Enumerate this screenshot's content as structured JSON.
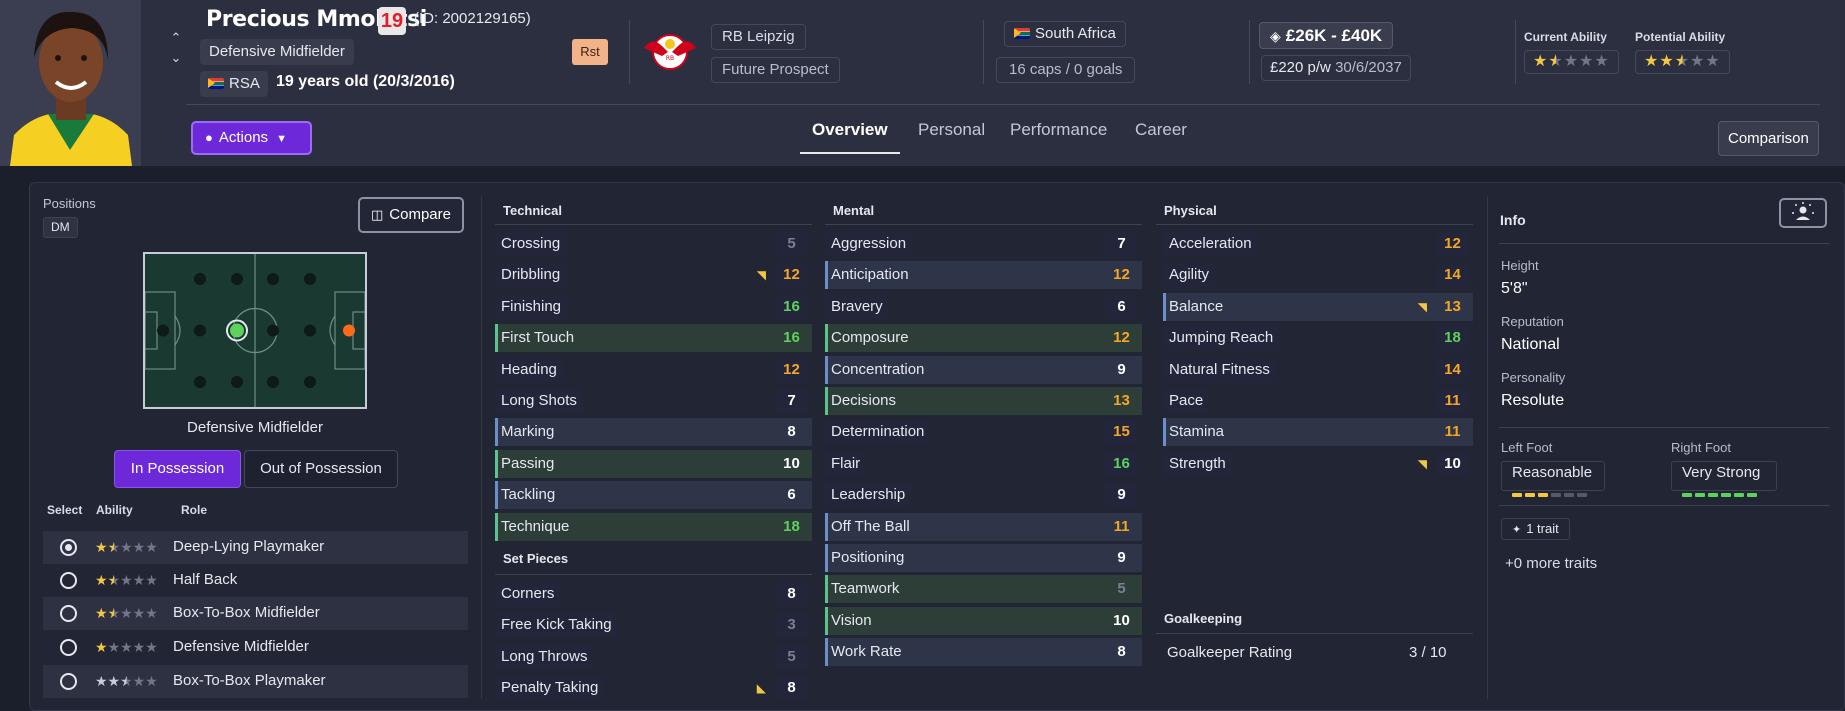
{
  "header": {
    "player_name": "Precious Mmolotsi",
    "age_badge": "19",
    "player_id": "(ID: 2002129165)",
    "position": "Defensive Midfielder",
    "nationality_code": "RSA",
    "age_dob": "19 years old (20/3/2016)",
    "rst_badge": "Rst",
    "club": "RB Leipzig",
    "club_status": "Future Prospect",
    "nation": "South Africa",
    "caps": "16 caps / 0 goals",
    "value": "£26K - £40K",
    "wage": "£220 p/w",
    "contract_end": "30/6/2037",
    "current_ability_label": "Current Ability",
    "potential_ability_label": "Potential Ability",
    "current_ability_stars": 1.5,
    "potential_ability_stars": 2.5,
    "actions_label": "Actions",
    "tabs": [
      "Overview",
      "Personal",
      "Performance",
      "Career"
    ],
    "active_tab": "Overview",
    "comparison_label": "Comparison"
  },
  "positions": {
    "label": "Positions",
    "chip": "DM",
    "compare_label": "Compare",
    "pitch_caption": "Defensive Midfielder",
    "in_possession": "In Possession",
    "out_of_possession": "Out of Possession",
    "columns": [
      "Select",
      "Ability",
      "Role"
    ],
    "roles": [
      {
        "name": "Deep-Lying Playmaker",
        "stars": 1.5,
        "selected": true,
        "star_color": "gold"
      },
      {
        "name": "Half Back",
        "stars": 1.5,
        "selected": false,
        "star_color": "gold"
      },
      {
        "name": "Box-To-Box Midfielder",
        "stars": 1.5,
        "selected": false,
        "star_color": "gold"
      },
      {
        "name": "Defensive Midfielder",
        "stars": 1,
        "selected": false,
        "star_color": "gold"
      },
      {
        "name": "Box-To-Box Playmaker",
        "stars": 2.5,
        "selected": false,
        "star_color": "silver"
      }
    ]
  },
  "technical": {
    "title": "Technical",
    "attributes": [
      {
        "name": "Crossing",
        "value": "5",
        "color": "gray",
        "highlight": "none",
        "trend": false
      },
      {
        "name": "Dribbling",
        "value": "12",
        "color": "orange",
        "highlight": "none",
        "trend": true
      },
      {
        "name": "Finishing",
        "value": "16",
        "color": "green",
        "highlight": "none",
        "trend": false
      },
      {
        "name": "First Touch",
        "value": "16",
        "color": "green",
        "highlight": "green",
        "trend": false
      },
      {
        "name": "Heading",
        "value": "12",
        "color": "orange",
        "highlight": "none",
        "trend": false
      },
      {
        "name": "Long Shots",
        "value": "7",
        "color": "white",
        "highlight": "none",
        "trend": false
      },
      {
        "name": "Marking",
        "value": "8",
        "color": "white",
        "highlight": "blue",
        "trend": false
      },
      {
        "name": "Passing",
        "value": "10",
        "color": "white",
        "highlight": "green",
        "trend": false
      },
      {
        "name": "Tackling",
        "value": "6",
        "color": "white",
        "highlight": "blue",
        "trend": false
      },
      {
        "name": "Technique",
        "value": "18",
        "color": "green",
        "highlight": "green",
        "trend": false
      }
    ]
  },
  "set_pieces": {
    "title": "Set Pieces",
    "attributes": [
      {
        "name": "Corners",
        "value": "8",
        "color": "white",
        "highlight": "none",
        "trend": false
      },
      {
        "name": "Free Kick Taking",
        "value": "3",
        "color": "gray",
        "highlight": "none",
        "trend": false
      },
      {
        "name": "Long Throws",
        "value": "5",
        "color": "gray",
        "highlight": "none",
        "trend": false
      },
      {
        "name": "Penalty Taking",
        "value": "8",
        "color": "white",
        "highlight": "none",
        "trend": "down"
      }
    ]
  },
  "mental": {
    "title": "Mental",
    "attributes": [
      {
        "name": "Aggression",
        "value": "7",
        "color": "white",
        "highlight": "none",
        "trend": false
      },
      {
        "name": "Anticipation",
        "value": "12",
        "color": "orange",
        "highlight": "blue",
        "trend": false
      },
      {
        "name": "Bravery",
        "value": "6",
        "color": "white",
        "highlight": "none",
        "trend": false
      },
      {
        "name": "Composure",
        "value": "12",
        "color": "orange",
        "highlight": "green",
        "trend": false
      },
      {
        "name": "Concentration",
        "value": "9",
        "color": "white",
        "highlight": "blue",
        "trend": false
      },
      {
        "name": "Decisions",
        "value": "13",
        "color": "orange",
        "highlight": "green",
        "trend": false
      },
      {
        "name": "Determination",
        "value": "15",
        "color": "orange",
        "highlight": "none",
        "trend": false
      },
      {
        "name": "Flair",
        "value": "16",
        "color": "green",
        "highlight": "none",
        "trend": false
      },
      {
        "name": "Leadership",
        "value": "9",
        "color": "white",
        "highlight": "none",
        "trend": false
      },
      {
        "name": "Off The Ball",
        "value": "11",
        "color": "orange",
        "highlight": "blue",
        "trend": false
      },
      {
        "name": "Positioning",
        "value": "9",
        "color": "white",
        "highlight": "blue",
        "trend": false
      },
      {
        "name": "Teamwork",
        "value": "5",
        "color": "gray",
        "highlight": "green",
        "trend": false
      },
      {
        "name": "Vision",
        "value": "10",
        "color": "white",
        "highlight": "green",
        "trend": false
      },
      {
        "name": "Work Rate",
        "value": "8",
        "color": "white",
        "highlight": "blue",
        "trend": false
      }
    ]
  },
  "physical": {
    "title": "Physical",
    "attributes": [
      {
        "name": "Acceleration",
        "value": "12",
        "color": "orange",
        "highlight": "none",
        "trend": false
      },
      {
        "name": "Agility",
        "value": "14",
        "color": "orange",
        "highlight": "none",
        "trend": false
      },
      {
        "name": "Balance",
        "value": "13",
        "color": "orange",
        "highlight": "blue",
        "trend": true
      },
      {
        "name": "Jumping Reach",
        "value": "18",
        "color": "green",
        "highlight": "none",
        "trend": false
      },
      {
        "name": "Natural Fitness",
        "value": "14",
        "color": "orange",
        "highlight": "none",
        "trend": false
      },
      {
        "name": "Pace",
        "value": "11",
        "color": "orange",
        "highlight": "none",
        "trend": false
      },
      {
        "name": "Stamina",
        "value": "11",
        "color": "orange",
        "highlight": "blue",
        "trend": false
      },
      {
        "name": "Strength",
        "value": "10",
        "color": "white",
        "highlight": "none",
        "trend": true
      }
    ]
  },
  "goalkeeping": {
    "title": "Goalkeeping",
    "rating_label": "Goalkeeper Rating",
    "rating_value": "3 / 10"
  },
  "info": {
    "title": "Info",
    "height_label": "Height",
    "height": "5'8\"",
    "reputation_label": "Reputation",
    "reputation": "National",
    "personality_label": "Personality",
    "personality": "Resolute",
    "left_foot_label": "Left Foot",
    "left_foot": "Reasonable",
    "left_foot_level": 3,
    "right_foot_label": "Right Foot",
    "right_foot": "Very Strong",
    "right_foot_level": 6,
    "trait_chip": "1 trait",
    "more_traits": "+0 more traits"
  },
  "colors": {
    "accent": "#6d28d9",
    "gold_star": "#f2c744",
    "green_value": "#5ed15c",
    "orange_value": "#f5a623"
  }
}
